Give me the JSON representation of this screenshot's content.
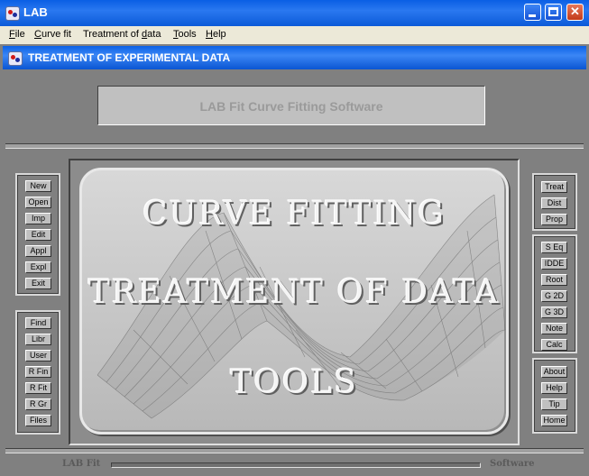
{
  "window": {
    "title": "LAB"
  },
  "menu": [
    {
      "pre": "",
      "u": "F",
      "post": "ile"
    },
    {
      "pre": "",
      "u": "C",
      "post": "urve fit"
    },
    {
      "pre": "Treatment of ",
      "u": "d",
      "post": "ata"
    },
    {
      "pre": "",
      "u": "T",
      "post": "ools"
    },
    {
      "pre": "",
      "u": "H",
      "post": "elp"
    }
  ],
  "child": {
    "title": "TREATMENT OF EXPERIMENTAL DATA"
  },
  "banner": "LAB Fit Curve Fitting Software",
  "left_top_buttons": [
    "New",
    "Open",
    "Imp",
    "Edit",
    "Appl",
    "Expl",
    "Exit"
  ],
  "left_bottom_buttons": [
    "Find",
    "Libr",
    "User",
    "R Fin",
    "R Fit",
    "R Gr",
    "Files"
  ],
  "right_top_buttons": [
    "Treat",
    "Dist",
    "Prop"
  ],
  "right_mid_buttons": [
    "S Eq",
    "IDDE",
    "Root",
    "G 2D",
    "G 3D",
    "Note",
    "Calc"
  ],
  "right_bottom_buttons": [
    "About",
    "Help",
    "Tip",
    "Home"
  ],
  "splash": {
    "line1": "CURVE FITTING",
    "line2": "TREATMENT OF DATA",
    "line3": "TOOLS"
  },
  "status": {
    "left": "LAB Fit",
    "right": "Software"
  }
}
